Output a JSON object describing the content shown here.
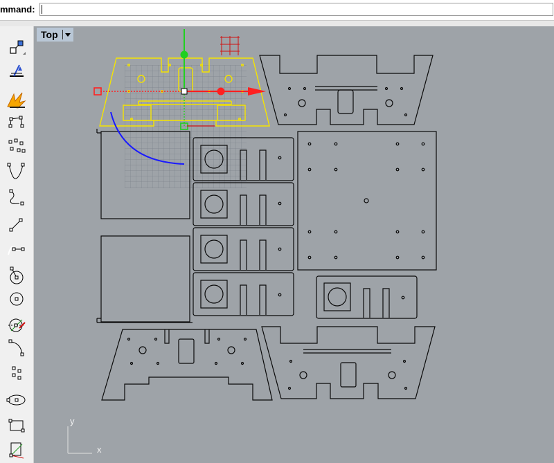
{
  "command_bar": {
    "label": "mmand:",
    "value": ""
  },
  "viewport": {
    "name": "Top",
    "axis_x_label": "x",
    "axis_y_label": "y"
  },
  "toolbar": {
    "tools": [
      {
        "icon": "scale-2d-icon"
      },
      {
        "icon": "extend-to-boundary-icon"
      },
      {
        "icon": "explode-icon"
      },
      {
        "icon": "control-point-curve-icon"
      },
      {
        "icon": "curve-through-points-icon"
      },
      {
        "icon": "interpolate-curve-icon"
      },
      {
        "icon": "sketch-curve-icon"
      },
      {
        "icon": "line-segment-icon"
      },
      {
        "icon": "polyline-icon"
      },
      {
        "icon": "circle-center-radius-icon"
      },
      {
        "icon": "circle-tangent-icon"
      },
      {
        "icon": "circle-3-point-icon"
      },
      {
        "icon": "arc-start-end-icon"
      },
      {
        "icon": "points-icon"
      },
      {
        "icon": "ellipse-icon"
      },
      {
        "icon": "rectangle-icon"
      },
      {
        "icon": "gumball-icon"
      }
    ]
  },
  "colors": {
    "viewport_bg": "#9ea3a8",
    "selected_outline": "#f5e400",
    "part_outline": "#0a0a0a",
    "gumball_x": "#ff2020",
    "gumball_y": "#20d020",
    "gumball_arc": "#1a1aff",
    "tab_bg": "#b9c7d6"
  }
}
